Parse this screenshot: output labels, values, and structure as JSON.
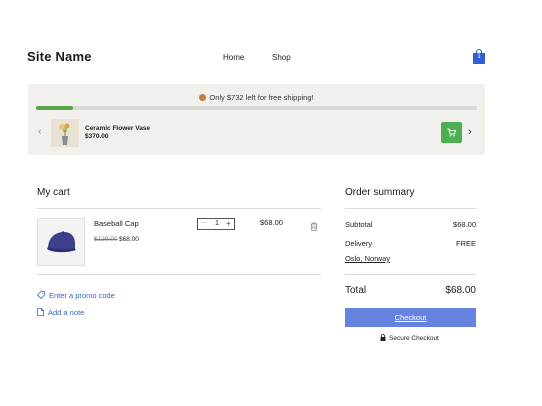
{
  "header": {
    "site_name": "Site Name",
    "nav": {
      "home": "Home",
      "shop": "Shop"
    },
    "bag_count": "1"
  },
  "shipping": {
    "message": "Only $732 left for free shipping!",
    "progress_fraction": 0.084
  },
  "upsell": {
    "product_name": "Ceramic Flower Vase",
    "product_price": "$370.00"
  },
  "cart": {
    "title": "My cart",
    "item": {
      "name": "Baseball Cap",
      "original_price": "$129.00",
      "sale_price": "$68.00",
      "quantity": "1",
      "line_total": "$68.00"
    },
    "promo_label": "Enter a promo code",
    "note_label": "Add a note"
  },
  "summary": {
    "title": "Order summary",
    "subtotal_label": "Subtotal",
    "subtotal_value": "$68.00",
    "delivery_label": "Delivery",
    "delivery_value": "FREE",
    "location": "Oslo, Norway",
    "total_label": "Total",
    "total_value": "$68.00",
    "checkout_label": "Checkout",
    "secure_label": "Secure Checkout"
  },
  "colors": {
    "accent_blue": "#6683e0",
    "link_blue": "#3566c9",
    "progress_green": "#5aa64a",
    "cart_button_green": "#4caf50",
    "bag_blue": "#2f5fd0"
  },
  "icons": {
    "bag": "shopping-bag-icon",
    "coin": "coin-icon",
    "cart": "cart-icon",
    "trash": "trash-icon",
    "tag": "tag-icon",
    "note": "note-icon",
    "lock": "lock-icon"
  }
}
